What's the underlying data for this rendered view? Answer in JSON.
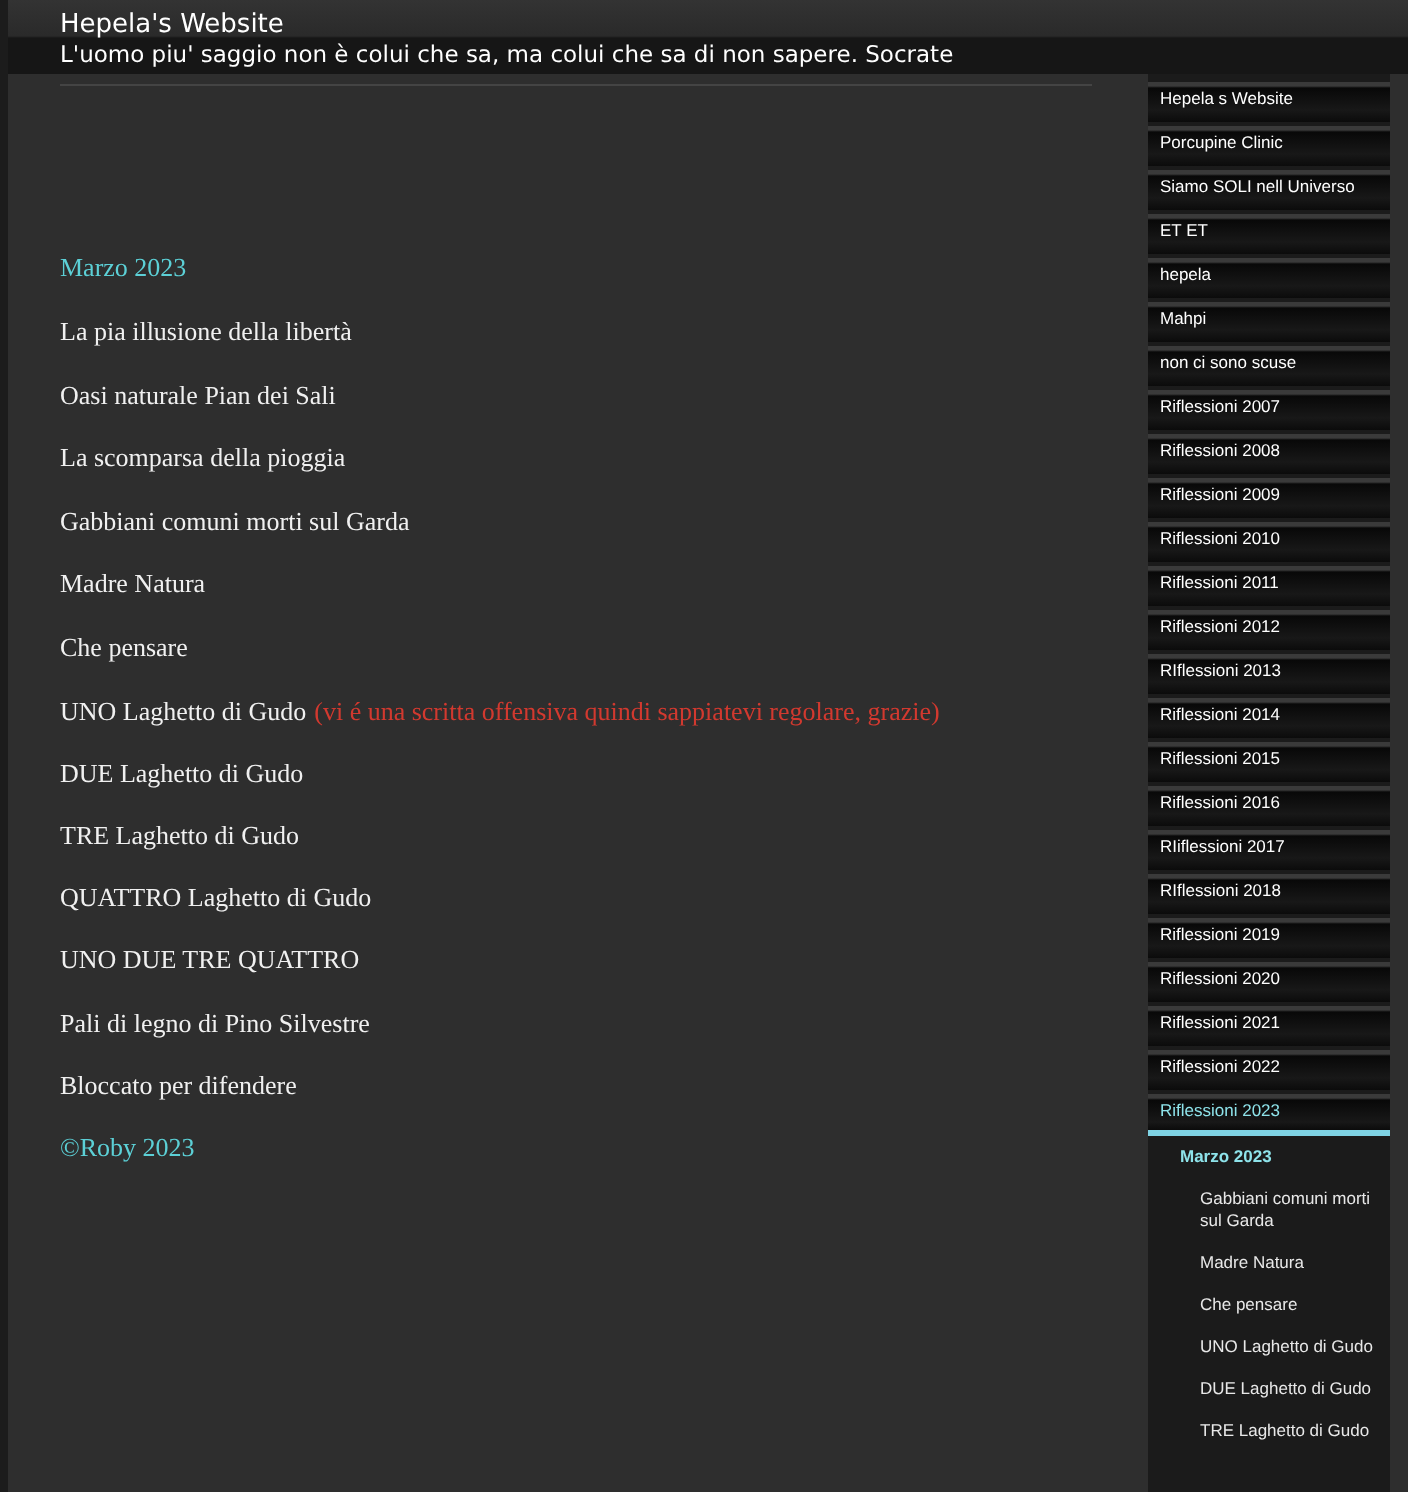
{
  "header": {
    "title": "Hepela's Website",
    "motto": "L'uomo piu' saggio non è colui che sa, ma colui che sa di non sapere. Socrate"
  },
  "content": {
    "sections": [
      {
        "items": [
          {
            "kind": "heading",
            "text": "Marzo 2023"
          }
        ]
      },
      {
        "items": [
          {
            "kind": "link",
            "text": "La pia illusione della libertà"
          }
        ]
      },
      {
        "items": [
          {
            "kind": "link",
            "text": "Oasi naturale Pian dei Sali"
          },
          {
            "kind": "link",
            "text": "La scomparsa della pioggia"
          }
        ]
      },
      {
        "items": [
          {
            "kind": "link",
            "text": "Gabbiani comuni morti sul Garda"
          },
          {
            "kind": "link",
            "text": "Madre Natura"
          }
        ]
      },
      {
        "items": [
          {
            "kind": "link",
            "text": "Che pensare"
          }
        ]
      },
      {
        "items": [
          {
            "kind": "link",
            "text": "UNO Laghetto di Gudo",
            "note": "(vi é una scritta offensiva quindi sappiatevi regolare, grazie)"
          },
          {
            "kind": "link",
            "text": "DUE Laghetto di Gudo"
          },
          {
            "kind": "link",
            "text": "TRE Laghetto di Gudo"
          },
          {
            "kind": "link",
            "text": "QUATTRO Laghetto di Gudo"
          },
          {
            "kind": "link",
            "text": "UNO DUE TRE QUATTRO"
          }
        ]
      },
      {
        "items": [
          {
            "kind": "link",
            "text": "Pali di legno di Pino Silvestre"
          },
          {
            "kind": "link",
            "text": "Bloccato per difendere"
          },
          {
            "kind": "heading",
            "text": "©Roby 2023"
          }
        ]
      }
    ]
  },
  "sidebar": {
    "items": [
      {
        "label": "Hepela s Website",
        "selected": false
      },
      {
        "label": "Porcupine Clinic",
        "selected": false
      },
      {
        "label": "Siamo SOLI nell Universo",
        "selected": false
      },
      {
        "label": "ET ET",
        "selected": false
      },
      {
        "label": "hepela",
        "selected": false
      },
      {
        "label": "Mahpi",
        "selected": false
      },
      {
        "label": "non ci sono scuse",
        "selected": false
      },
      {
        "label": "Riflessioni 2007",
        "selected": false
      },
      {
        "label": "Riflessioni 2008",
        "selected": false
      },
      {
        "label": "Riflessioni 2009",
        "selected": false
      },
      {
        "label": "Riflessioni 2010",
        "selected": false
      },
      {
        "label": "Riflessioni 2011",
        "selected": false
      },
      {
        "label": "Riflessioni 2012",
        "selected": false
      },
      {
        "label": "RIflessioni 2013",
        "selected": false
      },
      {
        "label": "Riflessioni 2014",
        "selected": false
      },
      {
        "label": "Riflessioni 2015",
        "selected": false
      },
      {
        "label": "Riflessioni 2016",
        "selected": false
      },
      {
        "label": "RIiflessioni 2017",
        "selected": false
      },
      {
        "label": "RIflessioni 2018",
        "selected": false
      },
      {
        "label": "Riflessioni 2019",
        "selected": false
      },
      {
        "label": "Riflessioni 2020",
        "selected": false
      },
      {
        "label": "Riflessioni 2021",
        "selected": false
      },
      {
        "label": "Riflessioni 2022",
        "selected": false
      },
      {
        "label": "Riflessioni 2023",
        "selected": true,
        "children": [
          {
            "label": "Marzo 2023",
            "selected": true,
            "children": [
              {
                "label": "Gabbiani comuni morti sul Garda",
                "selected": false
              },
              {
                "label": "Madre Natura",
                "selected": false
              },
              {
                "label": "Che pensare",
                "selected": false
              },
              {
                "label": "UNO Laghetto di Gudo",
                "selected": false
              },
              {
                "label": "DUE Laghetto di Gudo",
                "selected": false
              },
              {
                "label": "TRE Laghetto di Gudo",
                "selected": false
              }
            ]
          }
        ]
      }
    ]
  }
}
